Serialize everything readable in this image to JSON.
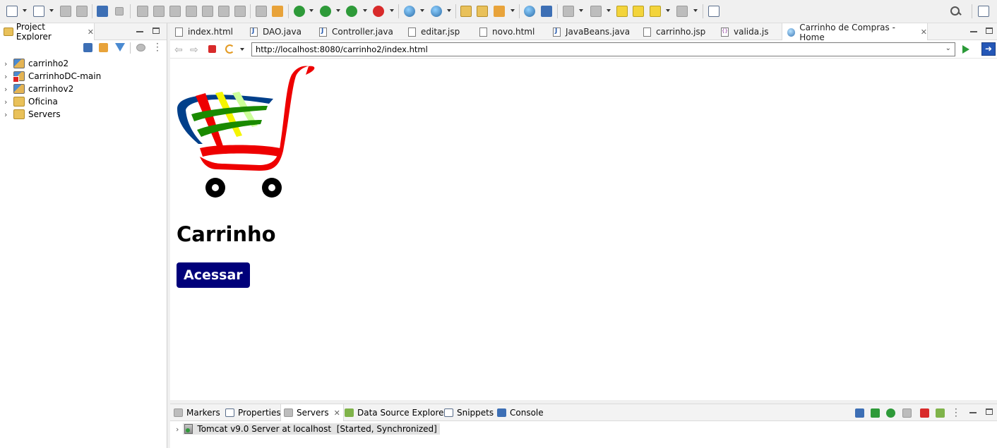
{
  "toolbar": {
    "icons": [
      "new-icon",
      "new-project-icon",
      "save-icon",
      "save-all-icon",
      "console-icon",
      "debug-skip-icon",
      "resume-icon",
      "suspend-icon",
      "terminate-icon",
      "step-into-icon",
      "step-over-icon",
      "step-return-icon",
      "use-step-filters-icon",
      "debug-icon",
      "run-icon",
      "coverage-icon",
      "external-tools-icon",
      "new-server-icon",
      "new-web-icon",
      "open-type-icon",
      "open-folder-icon",
      "search-icon",
      "globe-icon",
      "next-annotation-icon",
      "prev-annotation-icon",
      "back-icon",
      "forward-icon",
      "pin-editor-icon",
      "open-perspective-icon"
    ]
  },
  "project_explorer": {
    "tab_label": "Project Explorer",
    "tree": [
      {
        "label": "carrinho2",
        "icon": "web-project-icon"
      },
      {
        "label": "CarrinhoDC-main",
        "icon": "web-project-error-icon"
      },
      {
        "label": "carrinhov2",
        "icon": "web-project-icon"
      },
      {
        "label": "Oficina",
        "icon": "folder-project-icon"
      },
      {
        "label": "Servers",
        "icon": "folder-project-icon"
      }
    ]
  },
  "editor": {
    "tabs": [
      {
        "label": "index.html",
        "icon": "html-file-icon"
      },
      {
        "label": "DAO.java",
        "icon": "java-file-icon"
      },
      {
        "label": "Controller.java",
        "icon": "java-file-icon"
      },
      {
        "label": "editar.jsp",
        "icon": "jsp-file-icon"
      },
      {
        "label": "novo.html",
        "icon": "html-file-icon"
      },
      {
        "label": "JavaBeans.java",
        "icon": "java-file-icon"
      },
      {
        "label": "carrinho.jsp",
        "icon": "jsp-file-icon"
      },
      {
        "label": "valida.js",
        "icon": "js-file-icon"
      },
      {
        "label": "Carrinho de Compras - Home",
        "icon": "browser-globe-icon",
        "active": true
      }
    ],
    "url": "http://localhost:8080/carrinho2/index.html"
  },
  "page": {
    "heading": "Carrinho",
    "button_label": "Acessar",
    "colors": {
      "button_bg": "#00007a",
      "cart_red": "#ee0000",
      "cart_blue": "#003f8a",
      "cart_green": "#1a8a00",
      "cart_yellow": "#f5f500"
    }
  },
  "bottom_panel": {
    "tabs": [
      {
        "label": "Markers",
        "icon": "markers-icon"
      },
      {
        "label": "Properties",
        "icon": "properties-icon"
      },
      {
        "label": "Servers",
        "icon": "servers-icon",
        "active": true
      },
      {
        "label": "Data Source Explorer",
        "icon": "data-source-icon"
      },
      {
        "label": "Snippets",
        "icon": "snippets-icon"
      },
      {
        "label": "Console",
        "icon": "console-icon"
      }
    ],
    "server_entry": "Tomcat v9.0 Server at localhost  [Started, Synchronized]"
  }
}
